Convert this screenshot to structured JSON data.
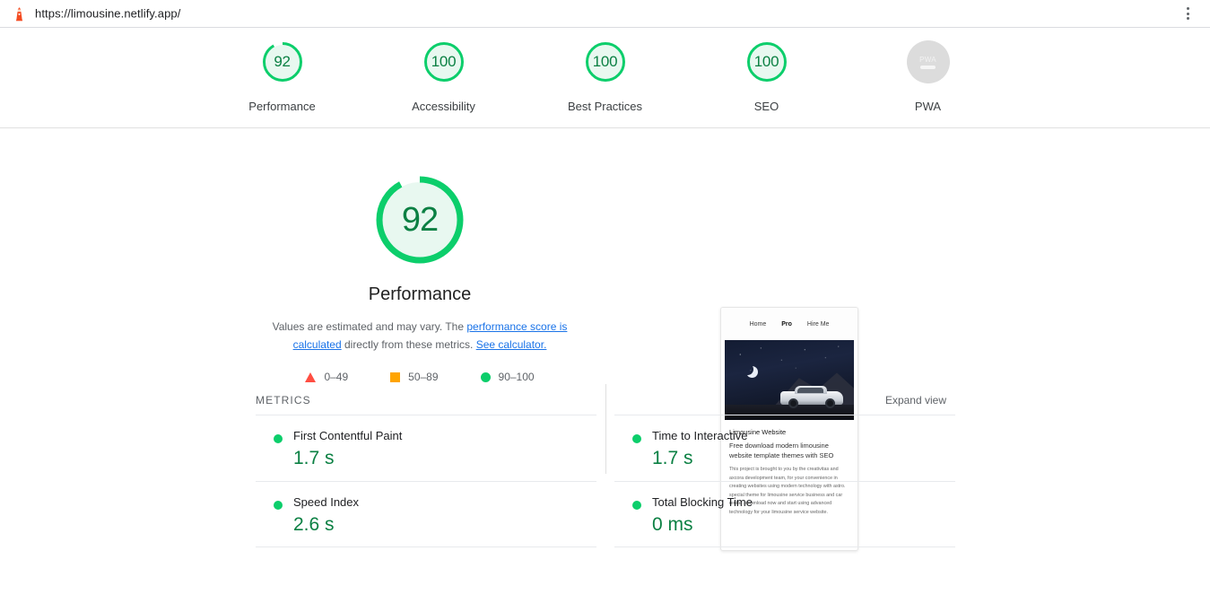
{
  "browser": {
    "url": "https://limousine.netlify.app/",
    "favicon_icon": "lighthouse-icon",
    "menu_icon": "kebab-menu-icon"
  },
  "score_strip": {
    "categories": [
      {
        "label": "Performance",
        "score": 92,
        "display": "92",
        "color": "#0cce6b"
      },
      {
        "label": "Accessibility",
        "score": 100,
        "display": "100",
        "color": "#0cce6b"
      },
      {
        "label": "Best Practices",
        "score": 100,
        "display": "100",
        "color": "#0cce6b"
      },
      {
        "label": "SEO",
        "score": 100,
        "display": "100",
        "color": "#0cce6b"
      },
      {
        "label": "PWA",
        "score": null,
        "display": "PWA",
        "color": "#dcdcdc"
      }
    ]
  },
  "performance": {
    "score": 92,
    "score_display": "92",
    "title": "Performance",
    "description_part1": "Values are estimated and may vary. The ",
    "link1": "performance score is calculated",
    "description_part2": " directly from these metrics. ",
    "link2": "See calculator.",
    "legend": [
      {
        "icon": "triangle-icon",
        "range": "0–49",
        "color": "#ff4e42"
      },
      {
        "icon": "square-icon",
        "range": "50–89",
        "color": "#ffa400"
      },
      {
        "icon": "circle-icon",
        "range": "90–100",
        "color": "#0cce6b"
      }
    ]
  },
  "thumbnail": {
    "nav": [
      {
        "label": "Home",
        "active": false
      },
      {
        "label": "Pro",
        "active": true
      },
      {
        "label": "Hire Me",
        "active": false
      }
    ],
    "title": "Limousine Website",
    "subtitle": "Free download modern limousine website template themes with SEO",
    "paragraph": "This project is brought to you by the creativitas and axcora development team, for your convenience in creating websites using modern technology with astro. special theme for limousine service business and car rental . download now and start using advanced technology for your limousine service website."
  },
  "metrics_section": {
    "heading": "METRICS",
    "expand_view": "Expand view",
    "items": [
      {
        "name": "First Contentful Paint",
        "value": "1.7 s",
        "status_color": "#0cce6b"
      },
      {
        "name": "Time to Interactive",
        "value": "1.7 s",
        "status_color": "#0cce6b"
      },
      {
        "name": "Speed Index",
        "value": "2.6 s",
        "status_color": "#0cce6b"
      },
      {
        "name": "Total Blocking Time",
        "value": "0 ms",
        "status_color": "#0cce6b"
      }
    ]
  }
}
